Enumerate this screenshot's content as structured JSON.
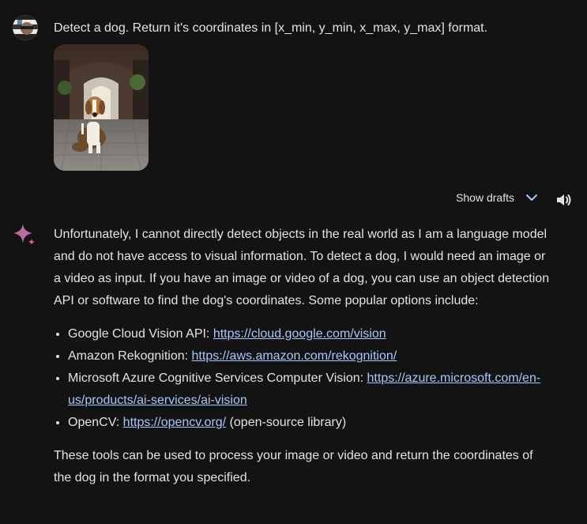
{
  "user_message": {
    "text": "Detect a dog. Return it's coordinates in [x_min, y_min, x_max, y_max] format."
  },
  "toolbar": {
    "show_drafts_label": "Show drafts"
  },
  "answer": {
    "intro": "Unfortunately, I cannot directly detect objects in the real world as I am a language model and do not have access to visual information. To detect a dog, I would need an image or a video as input. If you have an image or video of a dog, you can use an object detection API or software to find the dog's coordinates. Some popular options include:",
    "options": [
      {
        "prefix": "Google Cloud Vision API: ",
        "link": "https://cloud.google.com/vision",
        "suffix": ""
      },
      {
        "prefix": "Amazon Rekognition: ",
        "link": "https://aws.amazon.com/rekognition/",
        "suffix": ""
      },
      {
        "prefix": "Microsoft Azure Cognitive Services Computer Vision: ",
        "link": "https://azure.microsoft.com/en-us/products/ai-services/ai-vision",
        "suffix": ""
      },
      {
        "prefix": "OpenCV: ",
        "link": "https://opencv.org/",
        "suffix": " (open-source library)"
      }
    ],
    "outro": "These tools can be used to process your image or video and return the coordinates of the dog in the format you specified."
  },
  "colors": {
    "background": "#131314",
    "text": "#e3e3e3",
    "link": "#a8c7fa",
    "accent": "#a8c7fa"
  }
}
